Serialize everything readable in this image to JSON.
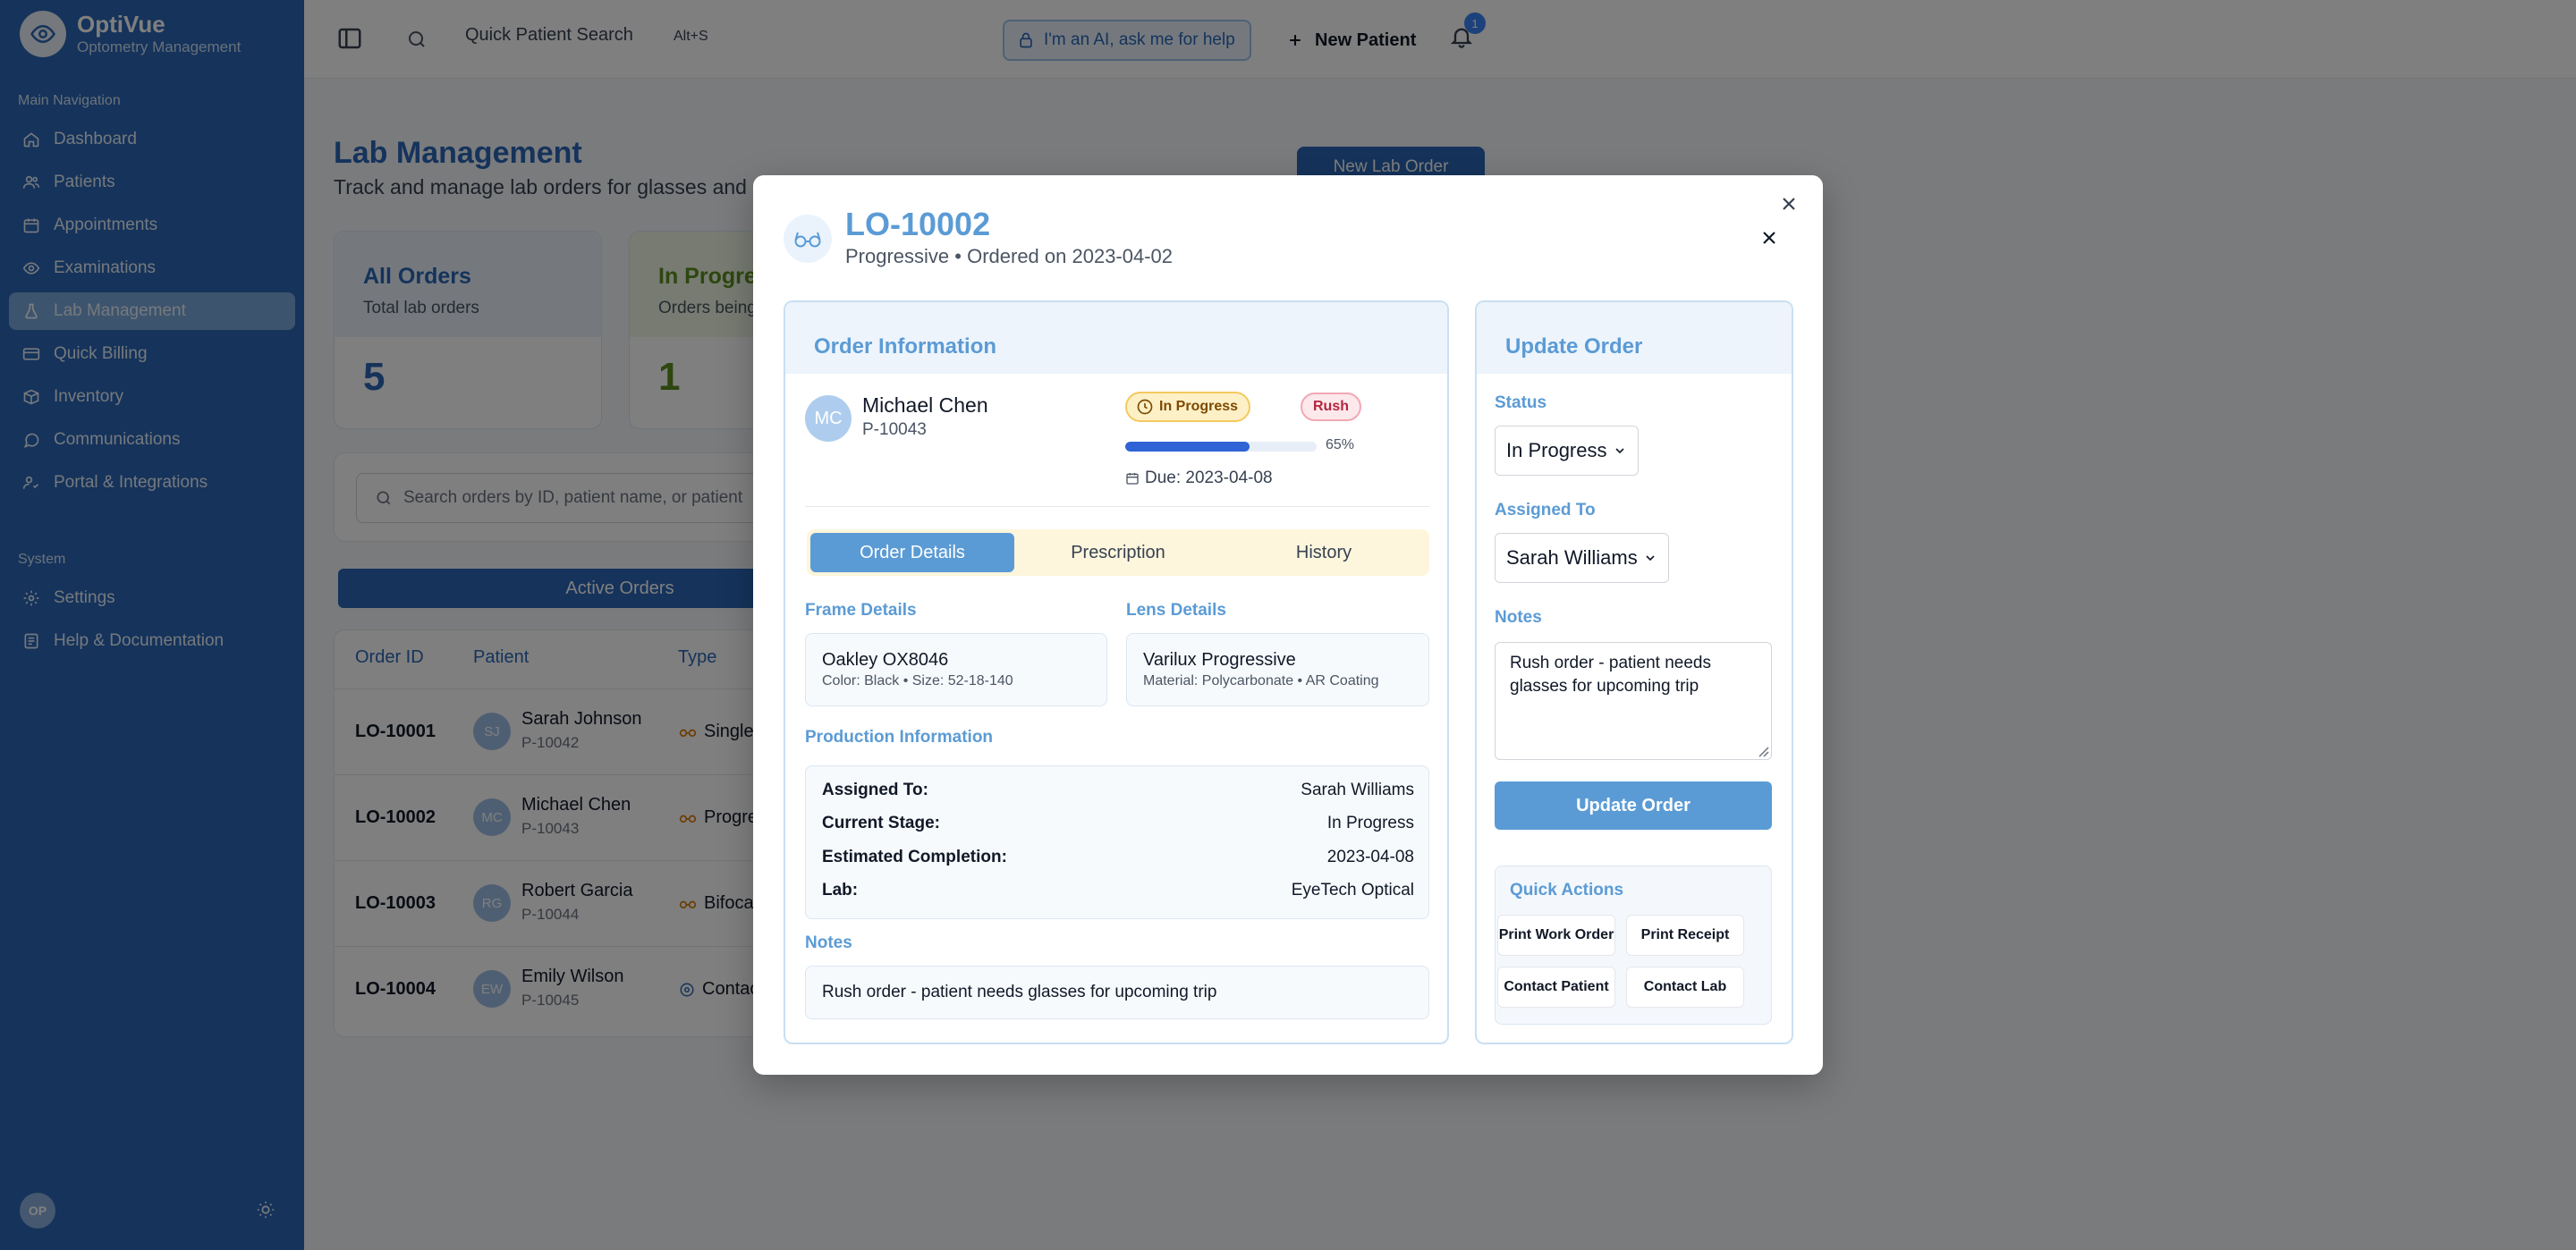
{
  "app": {
    "name": "OptiVue",
    "tagline": "Optometry Management",
    "brand_color": "#2a67b6"
  },
  "sidebar": {
    "main_section": "Main Navigation",
    "items": [
      {
        "label": "Dashboard",
        "icon": "home-icon"
      },
      {
        "label": "Patients",
        "icon": "users-icon"
      },
      {
        "label": "Appointments",
        "icon": "calendar-icon"
      },
      {
        "label": "Examinations",
        "icon": "eye-icon"
      },
      {
        "label": "Lab Management",
        "icon": "flask-icon",
        "active": true
      },
      {
        "label": "Quick Billing",
        "icon": "credit-card-icon"
      },
      {
        "label": "Inventory",
        "icon": "package-icon"
      },
      {
        "label": "Communications",
        "icon": "message-icon"
      },
      {
        "label": "Portal & Integrations",
        "icon": "link-icon"
      }
    ],
    "system_section": "System",
    "system_items": [
      {
        "label": "Settings",
        "icon": "gear-icon"
      },
      {
        "label": "Help & Documentation",
        "icon": "book-icon"
      }
    ],
    "user_initials": "OP"
  },
  "topbar": {
    "search_label": "Quick Patient Search",
    "search_shortcut": "Alt+S",
    "ai_label": "I'm an AI, ask me for help",
    "new_patient_label": "New Patient",
    "notification_count": "1"
  },
  "page": {
    "title": "Lab Management",
    "subtitle": "Track and manage lab orders for glasses and c",
    "new_lab_order": "New Lab Order",
    "stats": [
      {
        "title": "All Orders",
        "subtitle": "Total lab orders",
        "value": "5",
        "color": "#2a67b6"
      },
      {
        "title": "In Progress",
        "subtitle": "Orders being",
        "value": "1",
        "color": "#5a8f1f"
      }
    ],
    "search_placeholder": "Search orders by ID, patient name, or patient",
    "active_tab": "Active Orders",
    "table": {
      "headers": [
        "Order ID",
        "Patient",
        "Type"
      ],
      "rows": [
        {
          "id": "LO-10001",
          "initials": "SJ",
          "patient": "Sarah Johnson",
          "pid": "P-10042",
          "type": "Single"
        },
        {
          "id": "LO-10002",
          "initials": "MC",
          "patient": "Michael Chen",
          "pid": "P-10043",
          "type": "Progre"
        },
        {
          "id": "LO-10003",
          "initials": "RG",
          "patient": "Robert Garcia",
          "pid": "P-10044",
          "type": "Bifoca"
        },
        {
          "id": "LO-10004",
          "initials": "EW",
          "patient": "Emily Wilson",
          "pid": "P-10045",
          "type": "Contac"
        }
      ]
    }
  },
  "modal": {
    "order_id": "LO-10002",
    "subtitle": "Progressive • Ordered on 2023-04-02",
    "order_info": {
      "title": "Order Information",
      "patient_initials": "MC",
      "patient_name": "Michael Chen",
      "patient_id": "P-10043",
      "status": "In Progress",
      "priority": "Rush",
      "progress": 65,
      "progress_label": "65%",
      "due": "Due: 2023-04-08",
      "tabs": [
        "Order Details",
        "Prescription",
        "History"
      ],
      "frame_label": "Frame Details",
      "frame_name": "Oakley OX8046",
      "frame_meta": "Color: Black • Size: 52-18-140",
      "lens_label": "Lens Details",
      "lens_name": "Varilux Progressive",
      "lens_meta": "Material: Polycarbonate • AR Coating",
      "production_label": "Production Information",
      "production": [
        {
          "key": "Assigned To:",
          "value": "Sarah Williams"
        },
        {
          "key": "Current Stage:",
          "value": "In Progress"
        },
        {
          "key": "Estimated Completion:",
          "value": "2023-04-08"
        },
        {
          "key": "Lab:",
          "value": "EyeTech Optical"
        }
      ],
      "notes_label": "Notes",
      "notes": "Rush order - patient needs glasses for upcoming trip"
    },
    "update": {
      "title": "Update Order",
      "status_label": "Status",
      "status_value": "In Progress",
      "assigned_label": "Assigned To",
      "assigned_value": "Sarah Williams",
      "notes_label": "Notes",
      "notes_value": "Rush order - patient needs glasses for upcoming trip",
      "button": "Update Order",
      "quick_actions_title": "Quick Actions",
      "quick_actions": [
        "Print Work Order",
        "Print Receipt",
        "Contact Patient",
        "Contact Lab"
      ]
    }
  }
}
